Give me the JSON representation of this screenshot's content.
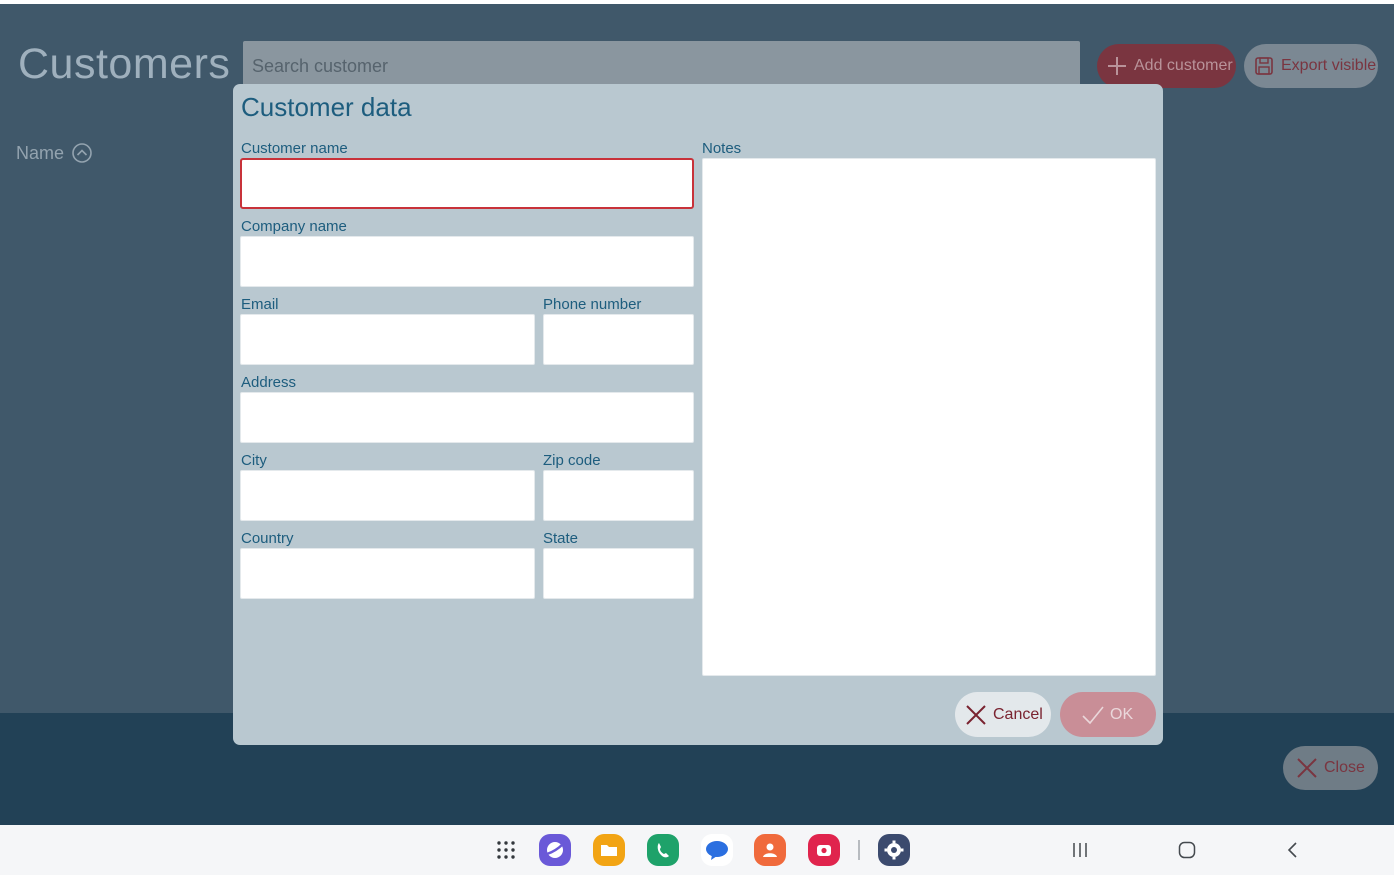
{
  "app": {
    "title": "Customers",
    "search": {
      "placeholder": "Search customer",
      "value": ""
    },
    "toolbar": {
      "add_label": "Add customer",
      "export_label": "Export visible"
    },
    "list": {
      "name_header": "Name"
    },
    "close_label": "Close"
  },
  "dialog": {
    "title": "Customer data",
    "fields": {
      "customer_name": {
        "label": "Customer name",
        "value": ""
      },
      "company_name": {
        "label": "Company name",
        "value": ""
      },
      "email": {
        "label": "Email",
        "value": ""
      },
      "phone": {
        "label": "Phone number",
        "value": ""
      },
      "address": {
        "label": "Address",
        "value": ""
      },
      "city": {
        "label": "City",
        "value": ""
      },
      "zip": {
        "label": "Zip code",
        "value": ""
      },
      "country": {
        "label": "Country",
        "value": ""
      },
      "state": {
        "label": "State",
        "value": ""
      },
      "notes": {
        "label": "Notes",
        "value": ""
      }
    },
    "cancel_label": "Cancel",
    "ok_label": "OK"
  },
  "navbar": {
    "dock": [
      "apps-grid-icon",
      "internet-browser-icon",
      "my-files-icon",
      "phone-icon",
      "messages-icon",
      "contacts-icon",
      "screen-recorder-icon",
      "settings-icon"
    ],
    "buttons": [
      "recent-apps-icon",
      "home-icon",
      "back-icon"
    ]
  },
  "colors": {
    "background": "#40586a",
    "dialog": "#b9c8d0",
    "accent": "#1d5d7e",
    "danger": "#7a3540",
    "invalid_border": "#c8323a"
  }
}
